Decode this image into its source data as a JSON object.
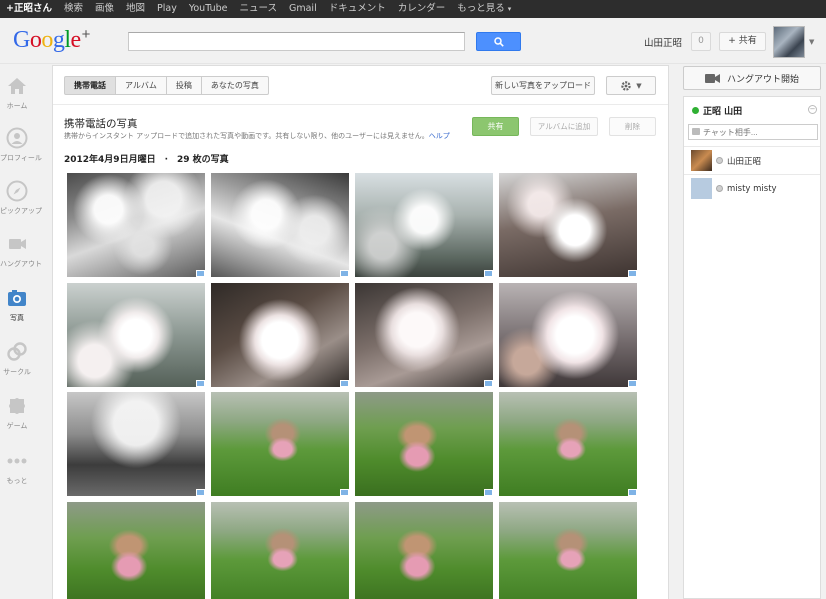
{
  "topbar": {
    "items": [
      "+正昭さん",
      "検索",
      "画像",
      "地図",
      "Play",
      "YouTube",
      "ニュース",
      "Gmail",
      "ドキュメント",
      "カレンダー",
      "もっと見る"
    ]
  },
  "header": {
    "logo_text": "Google",
    "logo_plus": "+",
    "search_value": "",
    "user_name": "山田正昭",
    "notification_count": "0",
    "share_label": "+ 共有"
  },
  "leftnav": {
    "items": [
      {
        "label": "ホーム",
        "icon": "home-icon"
      },
      {
        "label": "プロフィール",
        "icon": "profile-icon"
      },
      {
        "label": "ピックアップ",
        "icon": "compass-icon"
      },
      {
        "label": "ハングアウト",
        "icon": "hangout-icon"
      },
      {
        "label": "写真",
        "icon": "camera-icon"
      },
      {
        "label": "サークル",
        "icon": "circles-icon"
      },
      {
        "label": "ゲーム",
        "icon": "puzzle-icon"
      },
      {
        "label": "もっと",
        "icon": "more-dots-icon"
      }
    ],
    "active_index": 4
  },
  "photos_page": {
    "tabs": [
      "携帯電話",
      "アルバム",
      "投稿",
      "あなたの写真"
    ],
    "active_tab": 0,
    "upload_label": "新しい写真をアップロード",
    "section_title": "携帯電話の写真",
    "section_desc": "携帯からインスタント アップロードで追加された写真や動画です。共有しない限り、他のユーザーには見えません。",
    "help_link": "ヘルプ",
    "share_btn": "共有",
    "add_album_btn": "アルバムに追加",
    "delete_btn": "削除",
    "date_line": "2012年4月9日月曜日　·　29 枚の写真"
  },
  "sidebar": {
    "hangout_label": "ハングアウト開始",
    "chat_user": "正昭 山田",
    "chat_search_placeholder": "チャット相手...",
    "contacts": [
      {
        "name": "山田正昭"
      },
      {
        "name": "misty misty"
      }
    ]
  },
  "colors": {
    "accent_blue": "#4d90fe",
    "share_green": "#8cc66f",
    "online_green": "#2fb033",
    "active_nav": "#4285c9"
  }
}
